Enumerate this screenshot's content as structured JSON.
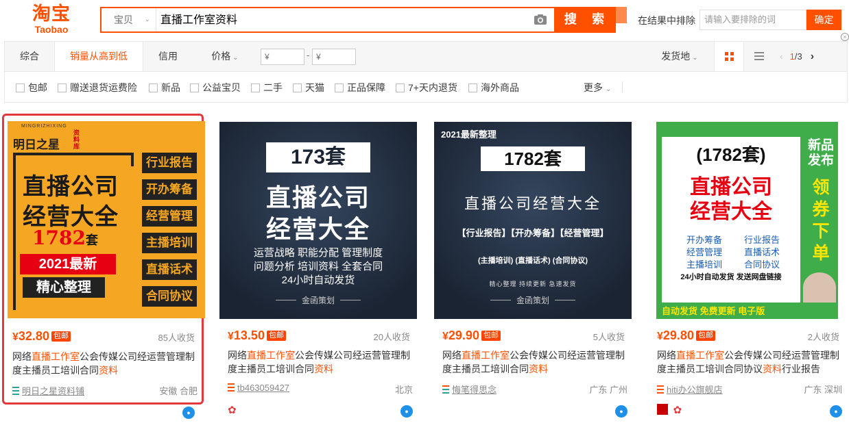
{
  "header": {
    "logo_cn": "淘宝",
    "logo_en": "Taobao",
    "search_category": "宝贝",
    "search_query": "直播工作室资料",
    "search_button": "搜 索",
    "exclude_label": "在结果中排除",
    "exclude_placeholder": "请输入要排除的词",
    "exclude_button": "确定"
  },
  "sort": {
    "items": [
      "综合",
      "销量从高到低",
      "信用",
      "价格"
    ],
    "active": "销量从高到低",
    "price_from": "¥",
    "price_dash": "-",
    "price_to": "¥",
    "ship_from": "发货地",
    "page_current": "1",
    "page_total": "/3"
  },
  "filters": {
    "items": [
      "包邮",
      "赠送退货运费险",
      "新品",
      "公益宝贝",
      "二手",
      "天猫",
      "正品保障",
      "7+天内退货",
      "海外商品"
    ],
    "more": "更多"
  },
  "products": [
    {
      "price": "32.80",
      "yen": "¥",
      "badge": "包邮",
      "sales": "85人收货",
      "title_pre": "网络",
      "title_hl": "直播工作室",
      "title_mid": "公会传媒公司经运营管理制度主播员工培训合同",
      "title_hl2": "资料",
      "title_post": "",
      "shop": "明日之星资料铺",
      "location": "安徽 合肥",
      "img": {
        "brand_en": "MINGRIZHIXING",
        "brand_cn": "明日之星",
        "seal": "资料库",
        "line1": "直播公司",
        "line2": "经营大全",
        "count": "1782",
        "count_unit": "套",
        "year": "2021最新",
        "sub": "精心整理",
        "tags": [
          "行业报告",
          "开办筹备",
          "经营管理",
          "主播培训",
          "直播话术",
          "合同协议"
        ]
      }
    },
    {
      "price": "13.50",
      "yen": "¥",
      "badge": "包邮",
      "sales": "20人收货",
      "title_pre": "网络",
      "title_hl": "直播工作室",
      "title_mid": "公会传媒公司经运营管理制度主播员工培训合同",
      "title_hl2": "资料",
      "title_post": "",
      "shop": "tb463059427",
      "location": "北京",
      "img": {
        "count": "173套",
        "line1": "直播公司",
        "line2": "经营大全",
        "sub1": "运营战略 职能分配 管理制度",
        "sub2": "问题分析 培训资料 全套合同",
        "sub3": "24小时自动发货",
        "footer": "金函策划"
      }
    },
    {
      "price": "29.90",
      "yen": "¥",
      "badge": "包邮",
      "sales": "5人收货",
      "title_pre": "网络",
      "title_hl": "直播工作室",
      "title_mid": "公会传媒公司经运营管理制度主播员工培训合同",
      "title_hl2": "资料",
      "title_post": "",
      "shop": "悔笔得思念",
      "location": "广东 广州",
      "img": {
        "top": "2021最新整理",
        "count": "1782套",
        "line1": "直播公司经营大全",
        "row1": "【行业报告】【开办筹备】【经营管理】",
        "row2": "(主播培训)  (直播话术)  (合同协议)",
        "row3": "精心整理  持续更新  急速发货",
        "footer": "金函策划"
      }
    },
    {
      "price": "29.80",
      "yen": "¥",
      "badge": "包邮",
      "sales": "2人收货",
      "title_pre": "网络",
      "title_hl": "直播工作室",
      "title_mid": "公会传媒公司经运营管理制度主播员工培训合同协议",
      "title_hl2": "资料",
      "title_post": "行业报告",
      "shop": "hiti办公旗舰店",
      "location": "广东 深圳",
      "img": {
        "count": "(1782套)",
        "line1": "直播公司",
        "line2": "经营大全",
        "grid": [
          "开办筹备",
          "行业报告",
          "经营管理",
          "直播话术",
          "主播培训",
          "合同协议"
        ],
        "note": "24小时自动发货  发送网盘链接",
        "side_top": "新品发布",
        "side_mid": "领券下单",
        "bottom": "自动发货  免费更新  电子版"
      }
    }
  ],
  "colors": {
    "brand": "#ff5000",
    "selected_border": "#e4393c"
  }
}
